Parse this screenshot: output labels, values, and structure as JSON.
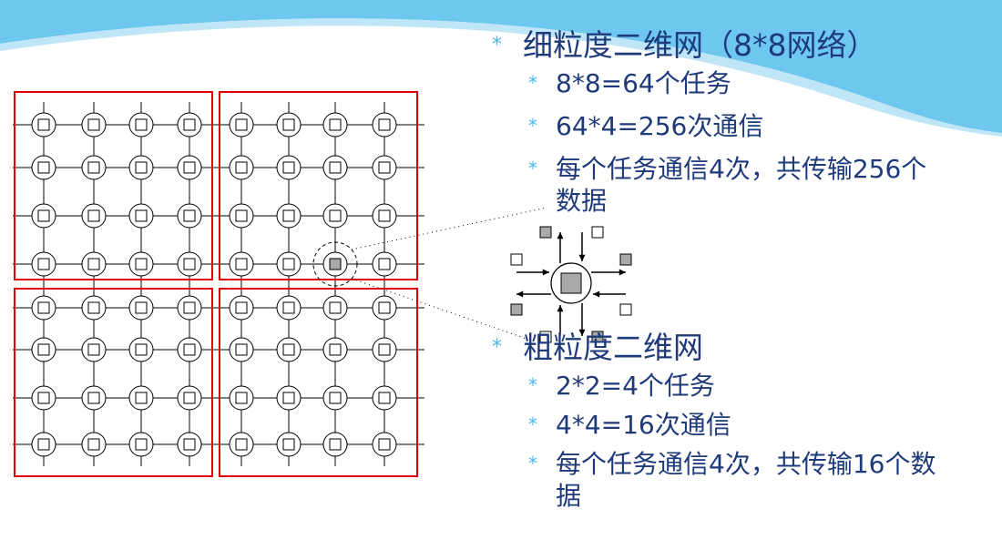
{
  "colors": {
    "banner": "#6dc7ee",
    "text": "#1f3a7a",
    "bullet": "#4cb8e8",
    "box": "#e00000",
    "highlight_cell": "#a9a9a9"
  },
  "fine": {
    "heading": "细粒度二维网（8*8网络）",
    "items": [
      "8*8=64个任务",
      "64*4=256次通信",
      "每个任务通信4次，共传输256个数据"
    ]
  },
  "coarse": {
    "heading": "粗粒度二维网",
    "items": [
      "2*2=4个任务",
      "4*4=16次通信",
      "每个任务通信4次，共传输16个数据"
    ]
  },
  "bullet_symbol": "*"
}
